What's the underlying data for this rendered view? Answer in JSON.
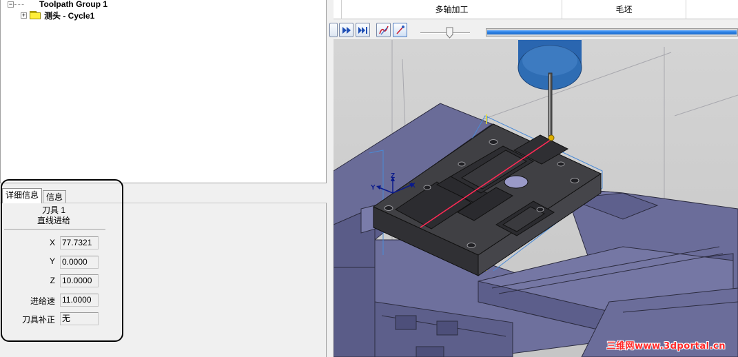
{
  "tree": {
    "root_label": "Toolpath Group 1",
    "root_expander": "−",
    "child_label": "测头 - Cycle1",
    "child_expander": "+"
  },
  "details": {
    "tabs": [
      {
        "label": "详细信息",
        "active": true
      },
      {
        "label": "信息",
        "active": false
      }
    ],
    "tool_name": "刀具 1",
    "move_type": "直线进给",
    "fields": [
      {
        "label": "X",
        "value": "77.7321"
      },
      {
        "label": "Y",
        "value": "0.0000"
      },
      {
        "label": "Z",
        "value": "10.0000"
      },
      {
        "label": "进给速",
        "value": "11.0000"
      },
      {
        "label": "刀具补正",
        "value": "无"
      }
    ]
  },
  "header": {
    "tabs": [
      {
        "label": "多轴加工"
      },
      {
        "label": "毛坯"
      }
    ]
  },
  "toolbar": {
    "buttons": [
      {
        "name": "step-forward-button",
        "icon": "step-forward-icon"
      },
      {
        "name": "fast-forward-button",
        "icon": "fast-forward-icon"
      },
      {
        "name": "skip-to-end-button",
        "icon": "skip-to-end-icon"
      },
      {
        "name": "show-toolpath-button",
        "icon": "toolpath-icon"
      },
      {
        "name": "show-tool-button",
        "icon": "tool-display-icon"
      }
    ],
    "speed_slider_level": 0.58,
    "playback_progress": 1.0
  },
  "viewport": {
    "triad_labels": {
      "y": "Y",
      "z": "Z",
      "x": "X"
    }
  },
  "watermark": "三维网www.3dportal.cn",
  "colors": {
    "part": "#3a3a3e",
    "vise": "#6d6f9c",
    "probe_body": "#2e6db4",
    "probe_path": "#ff2a55",
    "stock_outline": "#4a8ad6",
    "progress": "#2a7ee0"
  }
}
